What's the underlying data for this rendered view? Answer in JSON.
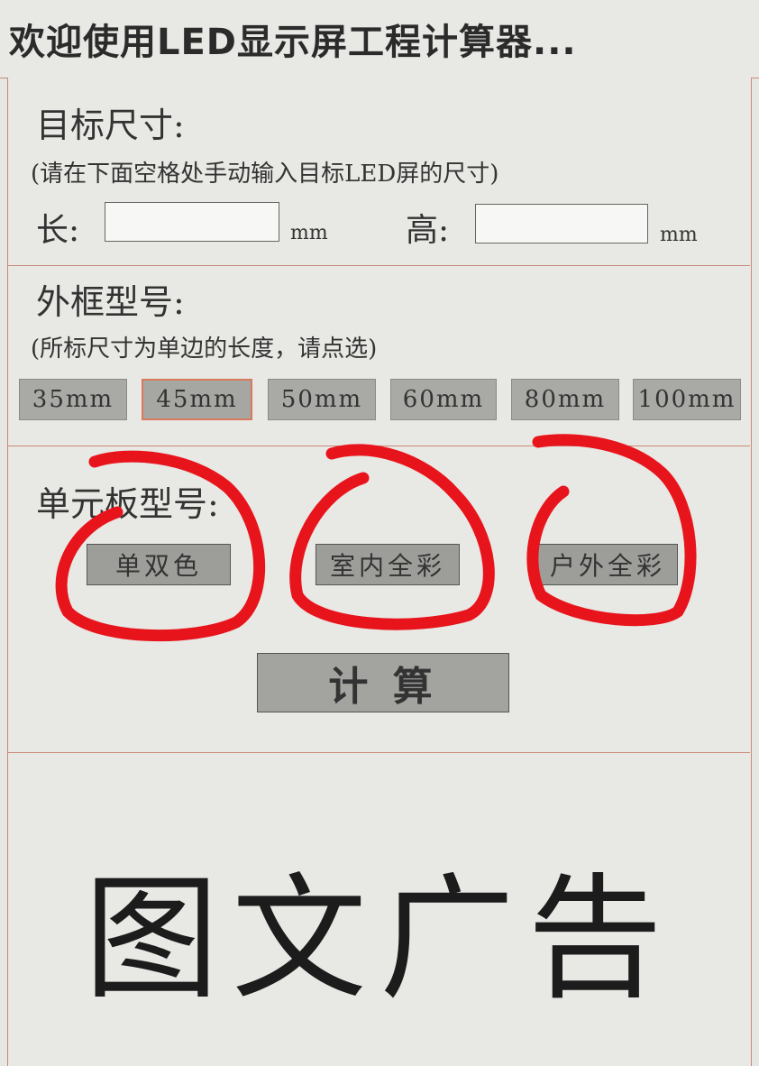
{
  "header": {
    "title": "欢迎使用LED显示屏工程计算器..."
  },
  "target_size": {
    "title": "目标尺寸:",
    "hint": "(请在下面空格处手动输入目标LED屏的尺寸)",
    "length_label": "长:",
    "height_label": "高:",
    "length_value": "",
    "height_value": "",
    "unit": "mm"
  },
  "frame_model": {
    "title": "外框型号:",
    "hint": "(所标尺寸为单边的长度，请点选)",
    "options": [
      "35mm",
      "45mm",
      "50mm",
      "60mm",
      "80mm",
      "100mm"
    ],
    "selected": "45mm"
  },
  "panel_model": {
    "title": "单元板型号:",
    "options": [
      "单双色",
      "室内全彩",
      "户外全彩"
    ]
  },
  "calculate_button": {
    "label": "计 算"
  },
  "ad": {
    "text": "图文广告"
  },
  "colors": {
    "background": "#e6e6e2",
    "border_accent": "#c98a7a",
    "button_fill": "#a9a9a6",
    "annotation": "#e8141c"
  }
}
